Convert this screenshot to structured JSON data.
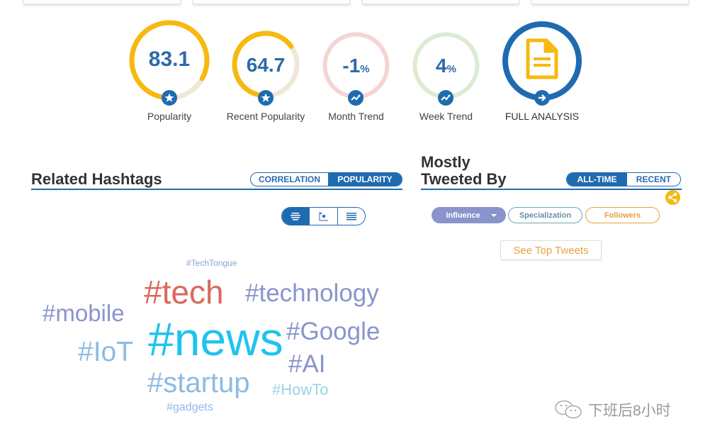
{
  "gauges": [
    {
      "id": "popularity",
      "value": "83.1",
      "suffix": "",
      "label": "Popularity",
      "fill_fraction": 0.83,
      "badge_icon": "star-icon"
    },
    {
      "id": "recent-popularity",
      "value": "64.7",
      "suffix": "",
      "label": "Recent Popularity",
      "fill_fraction": 0.65,
      "badge_icon": "star-icon"
    },
    {
      "id": "month-trend",
      "value": "-1",
      "suffix": "%",
      "label": "Month Trend",
      "badge_icon": "trend-icon"
    },
    {
      "id": "week-trend",
      "value": "4",
      "suffix": "%",
      "label": "Week Trend",
      "badge_icon": "trend-icon"
    },
    {
      "id": "full-analysis",
      "label": "FULL ANALYSIS",
      "icon": "document-icon",
      "badge_icon": "arrow-right-icon"
    }
  ],
  "colors": {
    "accent_blue": "#1f6bb0",
    "value_blue": "#2f6aa8",
    "gauge_yellow": "#f7b90f",
    "gauge_track": "#efe8d8",
    "month_ring": "#f6d4d4",
    "week_ring": "#dcebd2",
    "influence_purple": "#8a94cc",
    "followers_orange": "#e8a23d"
  },
  "related_hashtags": {
    "title": "Related Hashtags",
    "mode_toggle": [
      {
        "label": "CORRELATION",
        "active": false
      },
      {
        "label": "POPULARITY",
        "active": true
      }
    ],
    "view_buttons": [
      {
        "icon": "word-cloud-icon",
        "active": true
      },
      {
        "icon": "scatter-plot-icon",
        "active": false
      },
      {
        "icon": "list-icon",
        "active": false
      }
    ],
    "cloud": [
      {
        "text": "#TechTongue",
        "color": "#8ea0d2"
      },
      {
        "text": "#tech",
        "color": "#d9685e"
      },
      {
        "text": "#technology",
        "color": "#8a94cc"
      },
      {
        "text": "#mobile",
        "color": "#8a94cc"
      },
      {
        "text": "#news",
        "color": "#1ec3ef"
      },
      {
        "text": "#Google",
        "color": "#8a94cc"
      },
      {
        "text": "#IoT",
        "color": "#8cbbe3"
      },
      {
        "text": "#AI",
        "color": "#8a94cc"
      },
      {
        "text": "#startup",
        "color": "#8cbbe3"
      },
      {
        "text": "#HowTo",
        "color": "#9ad3ea"
      },
      {
        "text": "#gadgets",
        "color": "#8cbbe3"
      }
    ]
  },
  "mostly_tweeted_by": {
    "title_line1": "Mostly",
    "title_line2": "Tweeted By",
    "range_toggle": [
      {
        "label": "ALL-TIME",
        "active": true
      },
      {
        "label": "RECENT",
        "active": false
      }
    ],
    "filters": [
      {
        "label": "Influence",
        "active": true,
        "has_dropdown": true
      },
      {
        "label": "Specialization",
        "active": false
      },
      {
        "label": "Followers",
        "active": false
      }
    ],
    "see_top_tweets": "See Top Tweets"
  },
  "watermark": {
    "text": "下班后8小时"
  }
}
